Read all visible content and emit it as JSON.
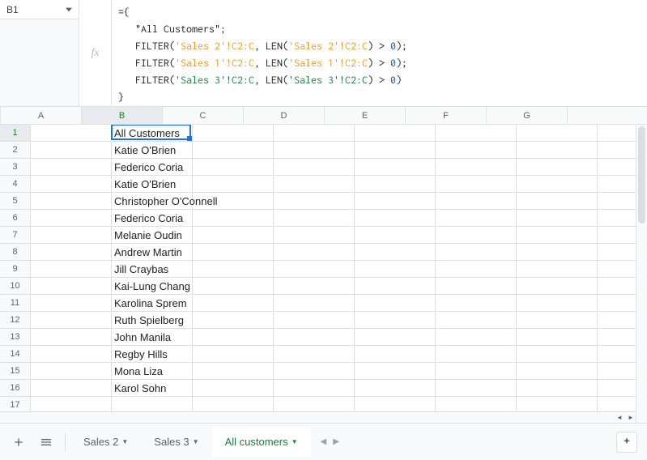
{
  "namebox": {
    "value": "B1"
  },
  "formula": {
    "open": "={",
    "line1_text": "\"All Customers\"",
    "filter1": {
      "fn": "FILTER",
      "open": "(",
      "ref": "'Sales 2'!C2:C",
      "sep": ",",
      "len_fn": "LEN",
      "len_open": "(",
      "len_ref": "'Sales 2'!C2:C",
      "len_close": ")",
      "gt": ">",
      "zero": "0",
      "close": ")"
    },
    "filter2": {
      "fn": "FILTER",
      "open": "(",
      "ref": "'Sales 1'!C2:C",
      "sep": ",",
      "len_fn": "LEN",
      "len_open": "(",
      "len_ref": "'Sales 1'!C2:C",
      "len_close": ")",
      "gt": ">",
      "zero": "0",
      "close": ")"
    },
    "filter3": {
      "fn": "FILTER",
      "open": "(",
      "ref": "'Sales 3'!C2:C",
      "sep": ",",
      "len_fn": "LEN",
      "len_open": "(",
      "len_ref": "'Sales 3'!C2:C",
      "len_close": ")",
      "gt": ">",
      "zero": "0",
      "close": ")"
    },
    "semicolon": ";",
    "close": "}"
  },
  "fx_label": "fx",
  "columns": [
    "A",
    "B",
    "C",
    "D",
    "E",
    "F",
    "G"
  ],
  "selected_col_index": 1,
  "selected_row_index": 0,
  "row_count": 17,
  "cells_colB": {
    "1": "All Customers",
    "2": "Katie O'Brien",
    "3": "Federico Coria",
    "4": "Katie O'Brien",
    "5": "Christopher O'Connell",
    "6": "Federico Coria",
    "7": "Melanie Oudin",
    "8": "Andrew Martin",
    "9": "Jill Craybas",
    "10": "Kai-Lung Chang",
    "11": "Karolina Sprem",
    "12": "Ruth Spielberg",
    "13": "John Manila",
    "14": "Regby Hills",
    "15": "Mona Liza",
    "16": "Karol Sohn"
  },
  "tabs": {
    "add_icon": "add-sheet-icon",
    "menu_icon": "all-sheets-icon",
    "items": [
      {
        "label": "Sales 2",
        "active": false
      },
      {
        "label": "Sales 3",
        "active": false
      },
      {
        "label": "All customers",
        "active": true
      }
    ],
    "nav_prev_icon": "tab-scroll-left-icon",
    "nav_next_icon": "tab-scroll-right-icon"
  },
  "explore_icon": "explore-icon"
}
